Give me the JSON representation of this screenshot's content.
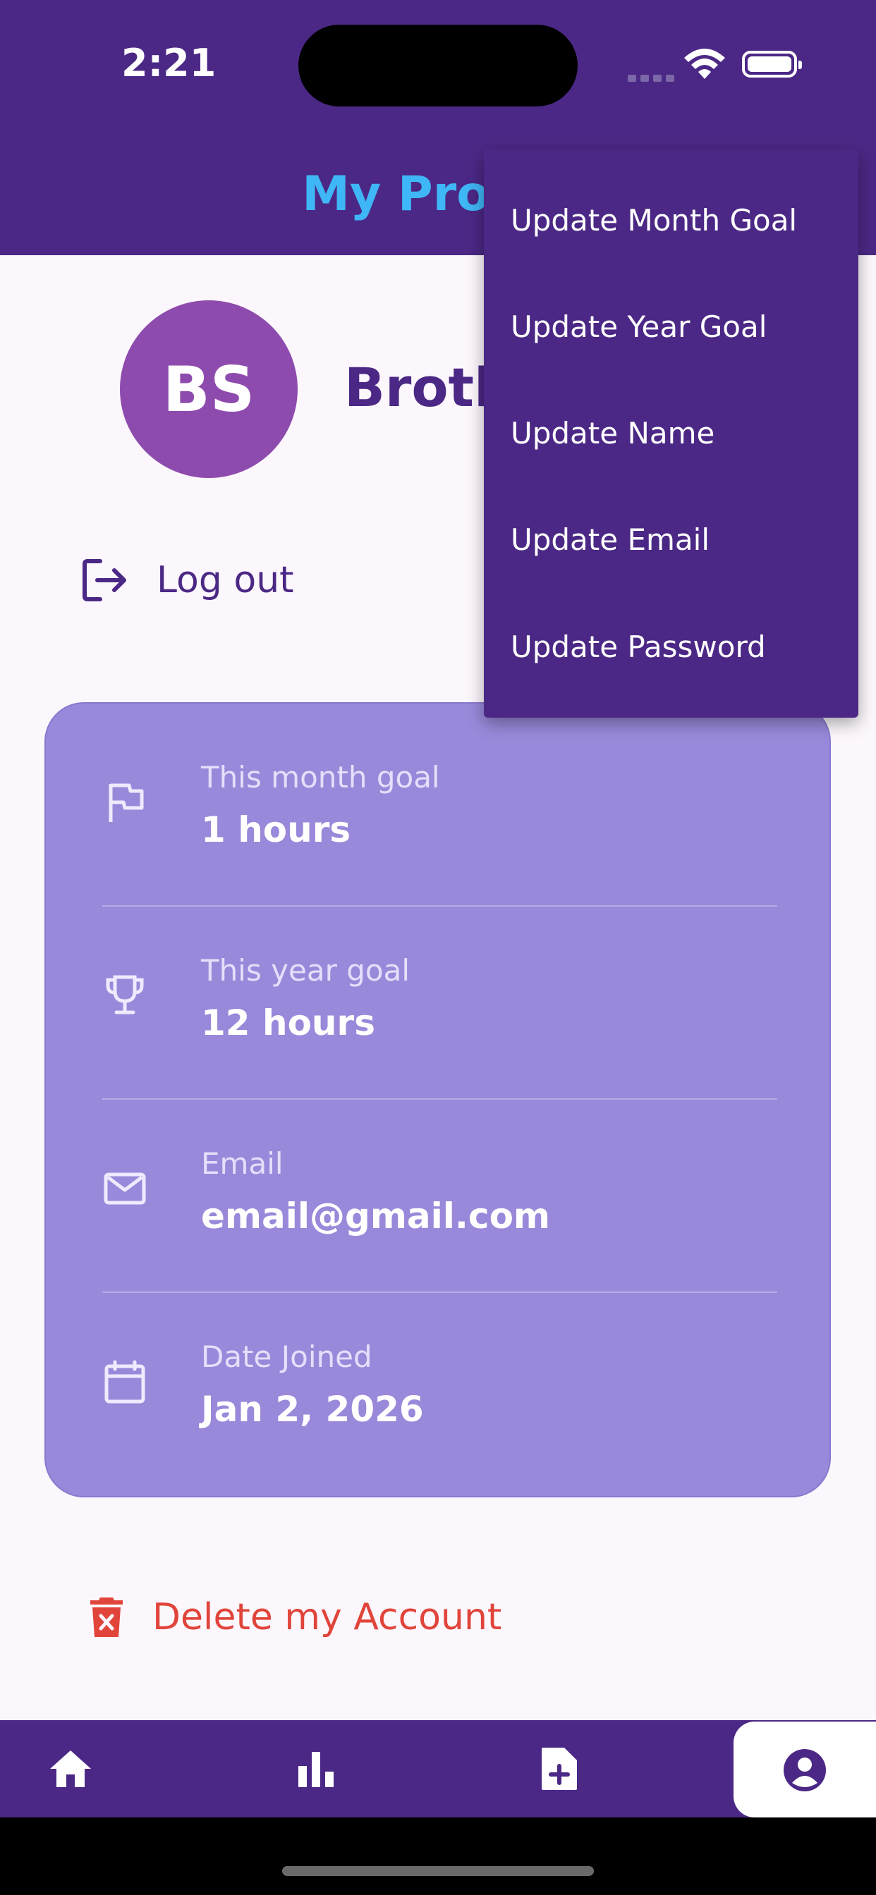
{
  "status_bar": {
    "time": "2:21"
  },
  "app_bar": {
    "title": "My Profile"
  },
  "profile": {
    "initials": "BS",
    "name": "Brother Smith"
  },
  "actions": {
    "logout_label": "Log out",
    "delete_label": "Delete my Account"
  },
  "info_rows": [
    {
      "label": "This month goal",
      "value": "1 hours",
      "icon": "flag-icon"
    },
    {
      "label": "This year goal",
      "value": "12 hours",
      "icon": "trophy-icon"
    },
    {
      "label": "Email",
      "value": "email@gmail.com",
      "icon": "mail-icon"
    },
    {
      "label": "Date Joined",
      "value": "Jan 2, 2026",
      "icon": "calendar-icon"
    }
  ],
  "menu": {
    "items": [
      "Update Month Goal",
      "Update Year Goal",
      "Update Name",
      "Update Email",
      "Update Password"
    ]
  },
  "bottom_nav": {
    "items": [
      "home-icon",
      "bar-chart-icon",
      "add-report-icon",
      "profile-icon"
    ],
    "active_index": 3
  },
  "colors": {
    "primary": "#4b2885",
    "title_accent": "#3fb6f5",
    "card": "#9a89da",
    "avatar": "#8e4bae",
    "danger": "#e0443a",
    "background": "#fcf7fc"
  }
}
